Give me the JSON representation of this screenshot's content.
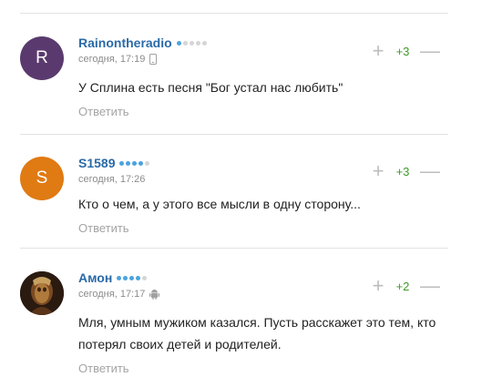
{
  "colors": {
    "accent": "#2a6aa8",
    "score": "#3d9a28",
    "dot_active": "#4aa3df",
    "dot_inactive": "#d5d5d5"
  },
  "comments": [
    {
      "avatar_letter": "R",
      "avatar_color": "#5a3a6e",
      "author": "Raino​ntheradio",
      "rating_dots": 1,
      "time": "сегодня, 17:19",
      "device": "phone-icon",
      "text": "У Сплина есть песня \"Бог устал нас любить\"",
      "reply": "Ответить",
      "plus": "+",
      "score": "+3",
      "minus": "—"
    },
    {
      "avatar_letter": "S",
      "avatar_color": "#e07a12",
      "author": "S1589",
      "rating_dots": 4,
      "time": "сегодня, 17:26",
      "device": "",
      "text": "Кто о чем, а у этого все мысли в одну сторону...",
      "reply": "Ответить",
      "plus": "+",
      "score": "+3",
      "minus": "—"
    },
    {
      "avatar_letter": "",
      "avatar_color": "#3a2a1c",
      "author": "Амон",
      "rating_dots": 4,
      "time": "сегодня, 17:17",
      "device": "android-icon",
      "text": "Мля, умным мужиком казался. Пусть расскажет это тем, кто потерял своих детей и родителей.",
      "reply": "Ответить",
      "plus": "+",
      "score": "+2",
      "minus": "—"
    }
  ]
}
